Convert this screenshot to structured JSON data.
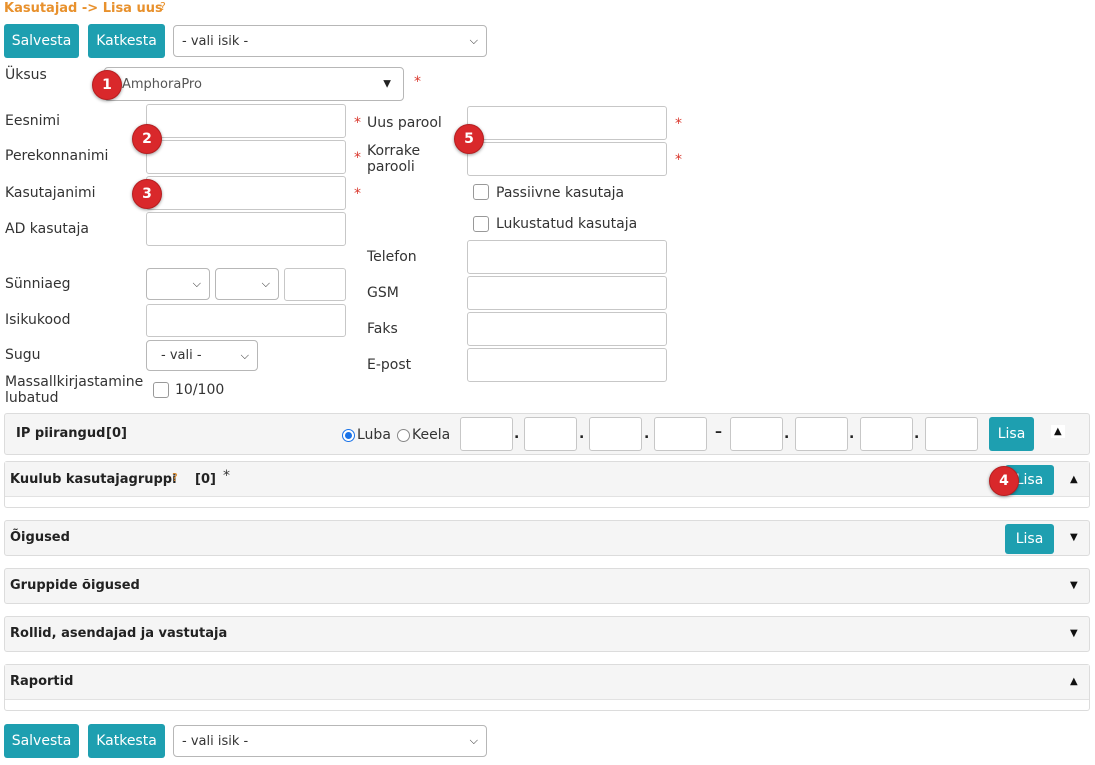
{
  "breadcrumb": "Kasutajad -> Lisa uus",
  "help_mark": "?",
  "required_mark": "*",
  "toolbar": {
    "save_label": "Salvesta",
    "cancel_label": "Katkesta",
    "person_select": "- vali isik -"
  },
  "form": {
    "unit_label": "Üksus",
    "unit_value": "AmphoraPro",
    "firstname_label": "Eesnimi",
    "lastname_label": "Perekonnanimi",
    "username_label": "Kasutajanimi",
    "ad_user_label": "AD kasutaja",
    "birthdate_label": "Sünniaeg",
    "idcode_label": "Isikukood",
    "gender_label": "Sugu",
    "gender_value": "- vali -",
    "mass_sign_label_line1": "Massallkirjastamine",
    "mass_sign_label_line2": "lubatud",
    "mass_sign_count": "10/100",
    "new_password_label": "Uus parool",
    "repeat_password_line1": "Korrake",
    "repeat_password_line2": "parooli",
    "passive_user_label": "Passiivne kasutaja",
    "locked_user_label": "Lukustatud kasutaja",
    "phone_label": "Telefon",
    "gsm_label": "GSM",
    "fax_label": "Faks",
    "email_label": "E-post"
  },
  "markers": [
    "1",
    "2",
    "3",
    "4",
    "5"
  ],
  "ip_section": {
    "title": "IP piirangud",
    "count": "[0]",
    "allow_label": "Luba",
    "deny_label": "Keela",
    "allow_selected": true,
    "dot": ".",
    "dash": "–",
    "add_label": "Lisa"
  },
  "sections": {
    "groups": {
      "title": "Kuulub kasutajagruppi",
      "count": "[0]",
      "add_label": "Lisa"
    },
    "rights": {
      "title": "Õigused",
      "add_label": "Lisa"
    },
    "group_rights": {
      "title": "Gruppide õigused"
    },
    "roles": {
      "title": "Rollid, asendajad ja vastutaja"
    },
    "reports": {
      "title": "Raportid"
    }
  },
  "icons": {
    "collapse": "triangle-up-icon",
    "expand": "triangle-down-icon",
    "select": "chevron-down-icon"
  },
  "colors": {
    "accent": "#1e9fb0",
    "breadcrumb": "#e8912d",
    "required": "#d9362b",
    "marker": "#d9282b"
  }
}
